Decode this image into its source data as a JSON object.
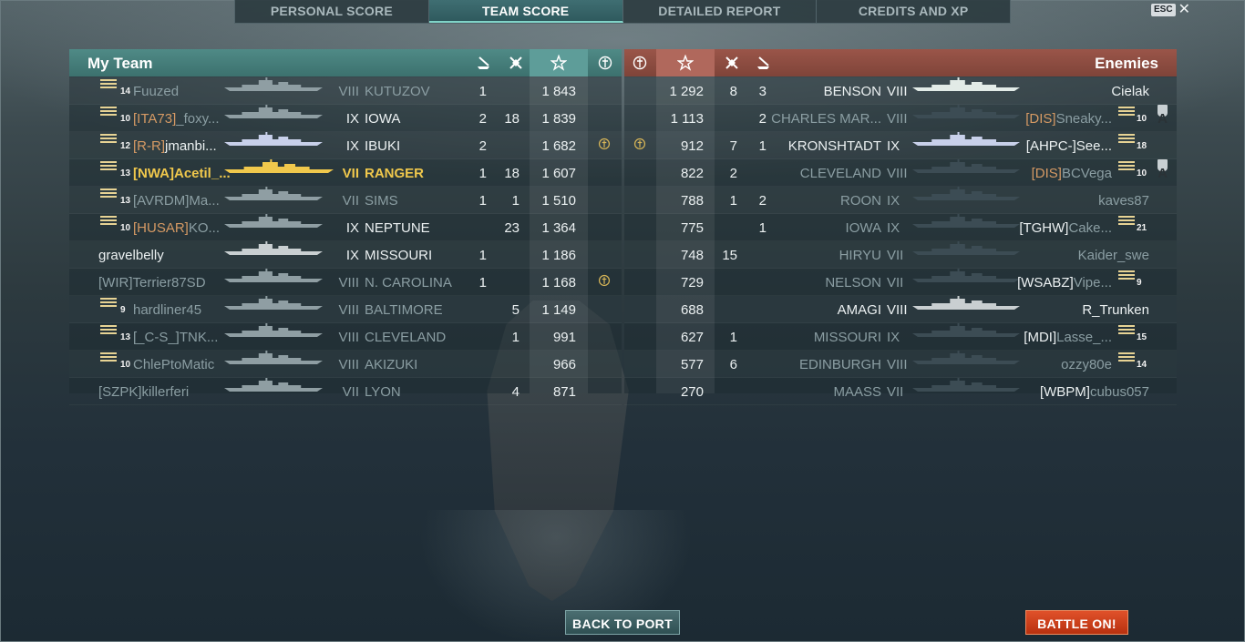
{
  "tabs": [
    {
      "label": "PERSONAL SCORE",
      "active": false
    },
    {
      "label": "TEAM SCORE",
      "active": true
    },
    {
      "label": "DETAILED REPORT",
      "active": false
    },
    {
      "label": "CREDITS AND XP",
      "active": false
    }
  ],
  "esc": {
    "key": "ESC",
    "close": "✕"
  },
  "my_team": {
    "title": "My Team",
    "header_icons": [
      "ship-kill-icon",
      "plane-kill-icon",
      "star-icon",
      "medal-icon"
    ],
    "rows": [
      {
        "rank": "14",
        "clan": "",
        "player": "Fuuzed",
        "tier": "VIII",
        "ship": "KUTUZOV",
        "kills": "1",
        "planes": "",
        "score": "1 843",
        "medal": false,
        "style": "dim",
        "silhouette_color": "#8f9ea3"
      },
      {
        "rank": "10",
        "clan": "[ITA73]",
        "player": "_foxy...",
        "tier": "IX",
        "ship": "IOWA",
        "kills": "2",
        "planes": "18",
        "score": "1 839",
        "medal": false,
        "style": "orange",
        "silhouette_color": "#8f9ea3"
      },
      {
        "rank": "12",
        "clan": "[R-R]",
        "player": "jmanbi...",
        "tier": "IX",
        "ship": "IBUKI",
        "kills": "2",
        "planes": "",
        "score": "1 682",
        "medal": true,
        "style": "bright",
        "silhouette_color": "#c8d0ea"
      },
      {
        "rank": "13",
        "clan": "[NWA]",
        "player": "Acetil_...",
        "tier": "VII",
        "ship": "RANGER",
        "kills": "1",
        "planes": "18",
        "score": "1 607",
        "medal": false,
        "style": "gold",
        "silhouette_color": "#f0c84c"
      },
      {
        "rank": "13",
        "clan": "[AVRDM]",
        "player": "Ma...",
        "tier": "VII",
        "ship": "SIMS",
        "kills": "1",
        "planes": "1",
        "score": "1 510",
        "medal": false,
        "style": "dim",
        "silhouette_color": "#8f9ea3"
      },
      {
        "rank": "10",
        "clan": "[HUSAR]",
        "player": "KO...",
        "tier": "IX",
        "ship": "NEPTUNE",
        "kills": "",
        "planes": "23",
        "score": "1 364",
        "medal": false,
        "style": "orange",
        "silhouette_color": "#8f9ea3"
      },
      {
        "rank": "",
        "clan": "",
        "player": "gravelbelly",
        "tier": "IX",
        "ship": "MISSOURI",
        "kills": "1",
        "planes": "",
        "score": "1 186",
        "medal": false,
        "style": "bright",
        "silhouette_color": "#c9cfd1"
      },
      {
        "rank": "",
        "clan": "[WIR]",
        "player": "Terrier87SD",
        "tier": "VIII",
        "ship": "N. CAROLINA",
        "kills": "1",
        "planes": "",
        "score": "1 168",
        "medal": true,
        "style": "dim",
        "silhouette_color": "#8f9ea3"
      },
      {
        "rank": "9",
        "clan": "",
        "player": "hardliner45",
        "tier": "VIII",
        "ship": "BALTIMORE",
        "kills": "",
        "planes": "5",
        "score": "1 149",
        "medal": false,
        "style": "dim",
        "silhouette_color": "#8f9ea3"
      },
      {
        "rank": "13",
        "clan": "[_C-S_]",
        "player": "TNK...",
        "tier": "VIII",
        "ship": "CLEVELAND",
        "kills": "",
        "planes": "1",
        "score": "991",
        "medal": false,
        "style": "dim",
        "silhouette_color": "#8f9ea3"
      },
      {
        "rank": "10",
        "clan": "",
        "player": "ChlePtoMatic",
        "tier": "VIII",
        "ship": "AKIZUKI",
        "kills": "",
        "planes": "",
        "score": "966",
        "medal": false,
        "style": "dim",
        "silhouette_color": "#8f9ea3"
      },
      {
        "rank": "",
        "clan": "[SZPK]",
        "player": "killerferi",
        "tier": "VII",
        "ship": "LYON",
        "kills": "",
        "planes": "4",
        "score": "871",
        "medal": false,
        "style": "dim",
        "silhouette_color": "#8f9ea3"
      }
    ]
  },
  "enemies": {
    "title": "Enemies",
    "header_icons": [
      "medal-icon",
      "star-icon",
      "plane-kill-icon",
      "ship-kill-icon"
    ],
    "rows": [
      {
        "medal": false,
        "score": "1 292",
        "planes": "8",
        "kills": "3",
        "ship": "BENSON",
        "tier": "VIII",
        "clan": "",
        "player": "Cielak",
        "rank": "",
        "division": "",
        "style": "bright",
        "silhouette_color": "#e2ebe7"
      },
      {
        "medal": false,
        "score": "1 113",
        "planes": "",
        "kills": "2",
        "ship": "CHARLES MAR...",
        "tier": "VIII",
        "clan": "[DIS]",
        "player": "Sneaky...",
        "rank": "10",
        "division": "A",
        "style": "dim",
        "silhouette_color": "#3c4c54"
      },
      {
        "medal": true,
        "score": "912",
        "planes": "7",
        "kills": "1",
        "ship": "KRONSHTADT",
        "tier": "IX",
        "clan": "[AHPC-]",
        "player": "See...",
        "rank": "18",
        "division": "",
        "style": "bright",
        "silhouette_color": "#c8d0ea"
      },
      {
        "medal": false,
        "score": "822",
        "planes": "2",
        "kills": "",
        "ship": "CLEVELAND",
        "tier": "VIII",
        "clan": "[DIS]",
        "player": "BCVega",
        "rank": "10",
        "division": "A",
        "style": "dim",
        "silhouette_color": "#3c4c54"
      },
      {
        "medal": false,
        "score": "788",
        "planes": "1",
        "kills": "2",
        "ship": "ROON",
        "tier": "IX",
        "clan": "",
        "player": "kaves87",
        "rank": "",
        "division": "",
        "style": "dim",
        "silhouette_color": "#3c4c54"
      },
      {
        "medal": false,
        "score": "775",
        "planes": "",
        "kills": "1",
        "ship": "IOWA",
        "tier": "IX",
        "clan": "[TGHW]",
        "player": "Cake...",
        "rank": "21",
        "division": "",
        "style": "dim",
        "silhouette_color": "#3c4c54"
      },
      {
        "medal": false,
        "score": "748",
        "planes": "15",
        "kills": "",
        "ship": "HIRYU",
        "tier": "VII",
        "clan": "",
        "player": "Kaider_swe",
        "rank": "",
        "division": "",
        "style": "dim",
        "silhouette_color": "#3c4c54"
      },
      {
        "medal": false,
        "score": "729",
        "planes": "",
        "kills": "",
        "ship": "NELSON",
        "tier": "VII",
        "clan": "[WSABZ]",
        "player": "Vipe...",
        "rank": "9",
        "division": "",
        "style": "dim",
        "silhouette_color": "#3c4c54"
      },
      {
        "medal": false,
        "score": "688",
        "planes": "",
        "kills": "",
        "ship": "AMAGI",
        "tier": "VIII",
        "clan": "",
        "player": "R_Trunken",
        "rank": "",
        "division": "",
        "style": "bright",
        "silhouette_color": "#c9cfd1"
      },
      {
        "medal": false,
        "score": "627",
        "planes": "1",
        "kills": "",
        "ship": "MISSOURI",
        "tier": "IX",
        "clan": "[MDI]",
        "player": "Lasse_...",
        "rank": "15",
        "division": "",
        "style": "dim",
        "silhouette_color": "#3c4c54"
      },
      {
        "medal": false,
        "score": "577",
        "planes": "6",
        "kills": "",
        "ship": "EDINBURGH",
        "tier": "VIII",
        "clan": "",
        "player": "ozzy80e",
        "rank": "14",
        "division": "",
        "style": "dim",
        "silhouette_color": "#3c4c54"
      },
      {
        "medal": false,
        "score": "270",
        "planes": "",
        "kills": "",
        "ship": "MAASS",
        "tier": "VII",
        "clan": "[WBPM]",
        "player": "cubus057",
        "rank": "",
        "division": "",
        "style": "dim",
        "silhouette_color": "#3c4c54"
      }
    ]
  },
  "buttons": {
    "back": "BACK TO PORT",
    "battle": "BATTLE ON!"
  },
  "colors": {
    "team_header": "#4f8a86",
    "enemy_header": "#9a5549",
    "battle_button": "#e0512a",
    "player_highlight": "#f0c84c"
  }
}
